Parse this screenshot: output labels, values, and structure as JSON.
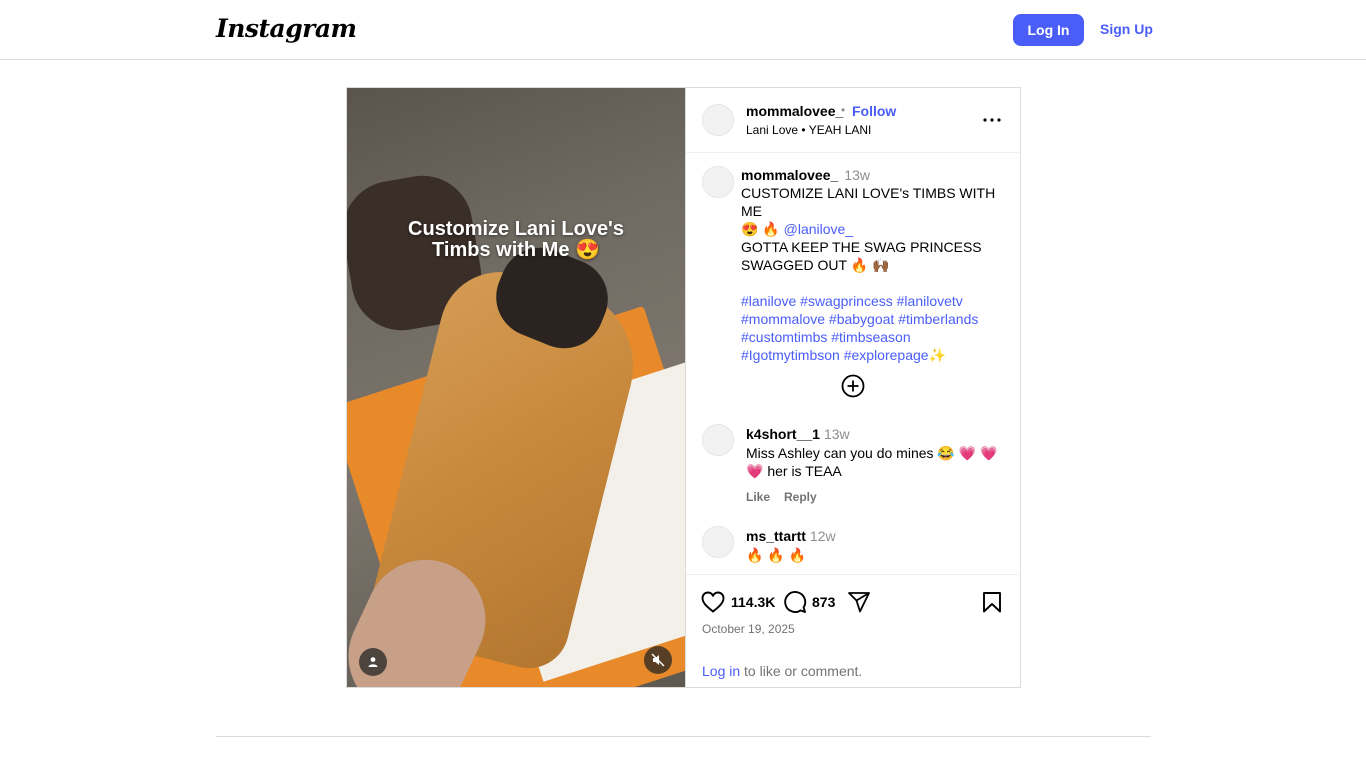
{
  "header": {
    "logo_text": "Instagram",
    "login_label": "Log In",
    "signup_label": "Sign Up"
  },
  "media": {
    "overlay_line1": "Customize Lani Love's",
    "overlay_line2": "Timbs with Me 😍"
  },
  "post_header": {
    "username": "mommalovee_",
    "separator": "•",
    "follow_label": "Follow",
    "subtitle": "Lani Love • YEAH LANI"
  },
  "caption": {
    "username": "mommalovee_",
    "time": "13w",
    "line1": "CUSTOMIZE LANI LOVE's TIMBS WITH ME",
    "line2_prefix": "😍 🔥 ",
    "mention": "@lanilove_",
    "line3": "GOTTA KEEP THE SWAG PRINCESS",
    "line4": "SWAGGED OUT 🔥 🙌🏾",
    "hashtags_line1": "#lanilove #swagprincess #lanilovetv",
    "hashtags_line2": "#mommalove #babygoat #timberlands",
    "hashtags_line3": "#customtimbs #timbseason",
    "hashtags_line4": "#Igotmytimbson #explorepage",
    "hashtags_line4_suffix": "✨"
  },
  "comments": [
    {
      "username": "k4short__1",
      "time": "13w",
      "text": "Miss Ashley can you do mines 😂 💗 💗 💗  her is TEAA",
      "like_label": "Like",
      "reply_label": "Reply"
    },
    {
      "username": "ms_ttartt",
      "time": "12w",
      "text": "🔥 🔥 🔥"
    }
  ],
  "stats": {
    "likes": "114.3K",
    "comments": "873"
  },
  "post_date": "October 19, 2025",
  "login_prompt": {
    "link": "Log in",
    "rest": " to like or comment."
  },
  "icons": {
    "like": "heart-icon",
    "comment": "comment-icon",
    "share": "share-icon",
    "save": "bookmark-icon",
    "more": "more-options-icon",
    "add": "plus-circle-icon",
    "mute": "muted-speaker-icon",
    "tag": "user-tag-icon"
  },
  "colors": {
    "accent": "#4a5df9",
    "border": "#dbdbdb",
    "muted_text": "#737373"
  }
}
